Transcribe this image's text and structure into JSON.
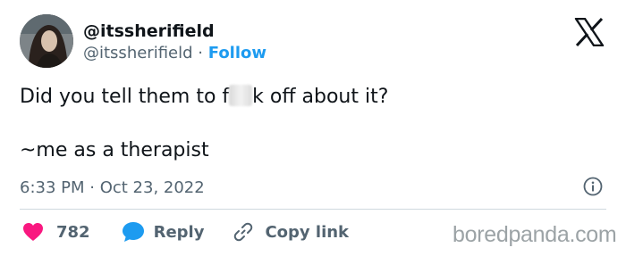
{
  "author": {
    "display_name": "@itssherifield",
    "handle": "@itssherifield",
    "separator": "·",
    "follow_label": "Follow"
  },
  "tweet": {
    "line1_before": "Did you tell them to f",
    "line1_after": "k off about it?",
    "line2": "~me as a therapist",
    "timestamp": "6:33 PM · Oct 23, 2022"
  },
  "actions": {
    "like_count": "782",
    "reply_label": "Reply",
    "copy_label": "Copy link"
  },
  "watermark": "boredpanda.com",
  "icons": {
    "brand": "x-logo-icon",
    "info": "info-icon",
    "like": "heart-icon",
    "reply": "speech-bubble-icon",
    "copy": "link-icon"
  },
  "colors": {
    "text": "#0f1419",
    "secondary": "#536471",
    "accent": "#1d9bf0",
    "heart": "#f91880"
  }
}
